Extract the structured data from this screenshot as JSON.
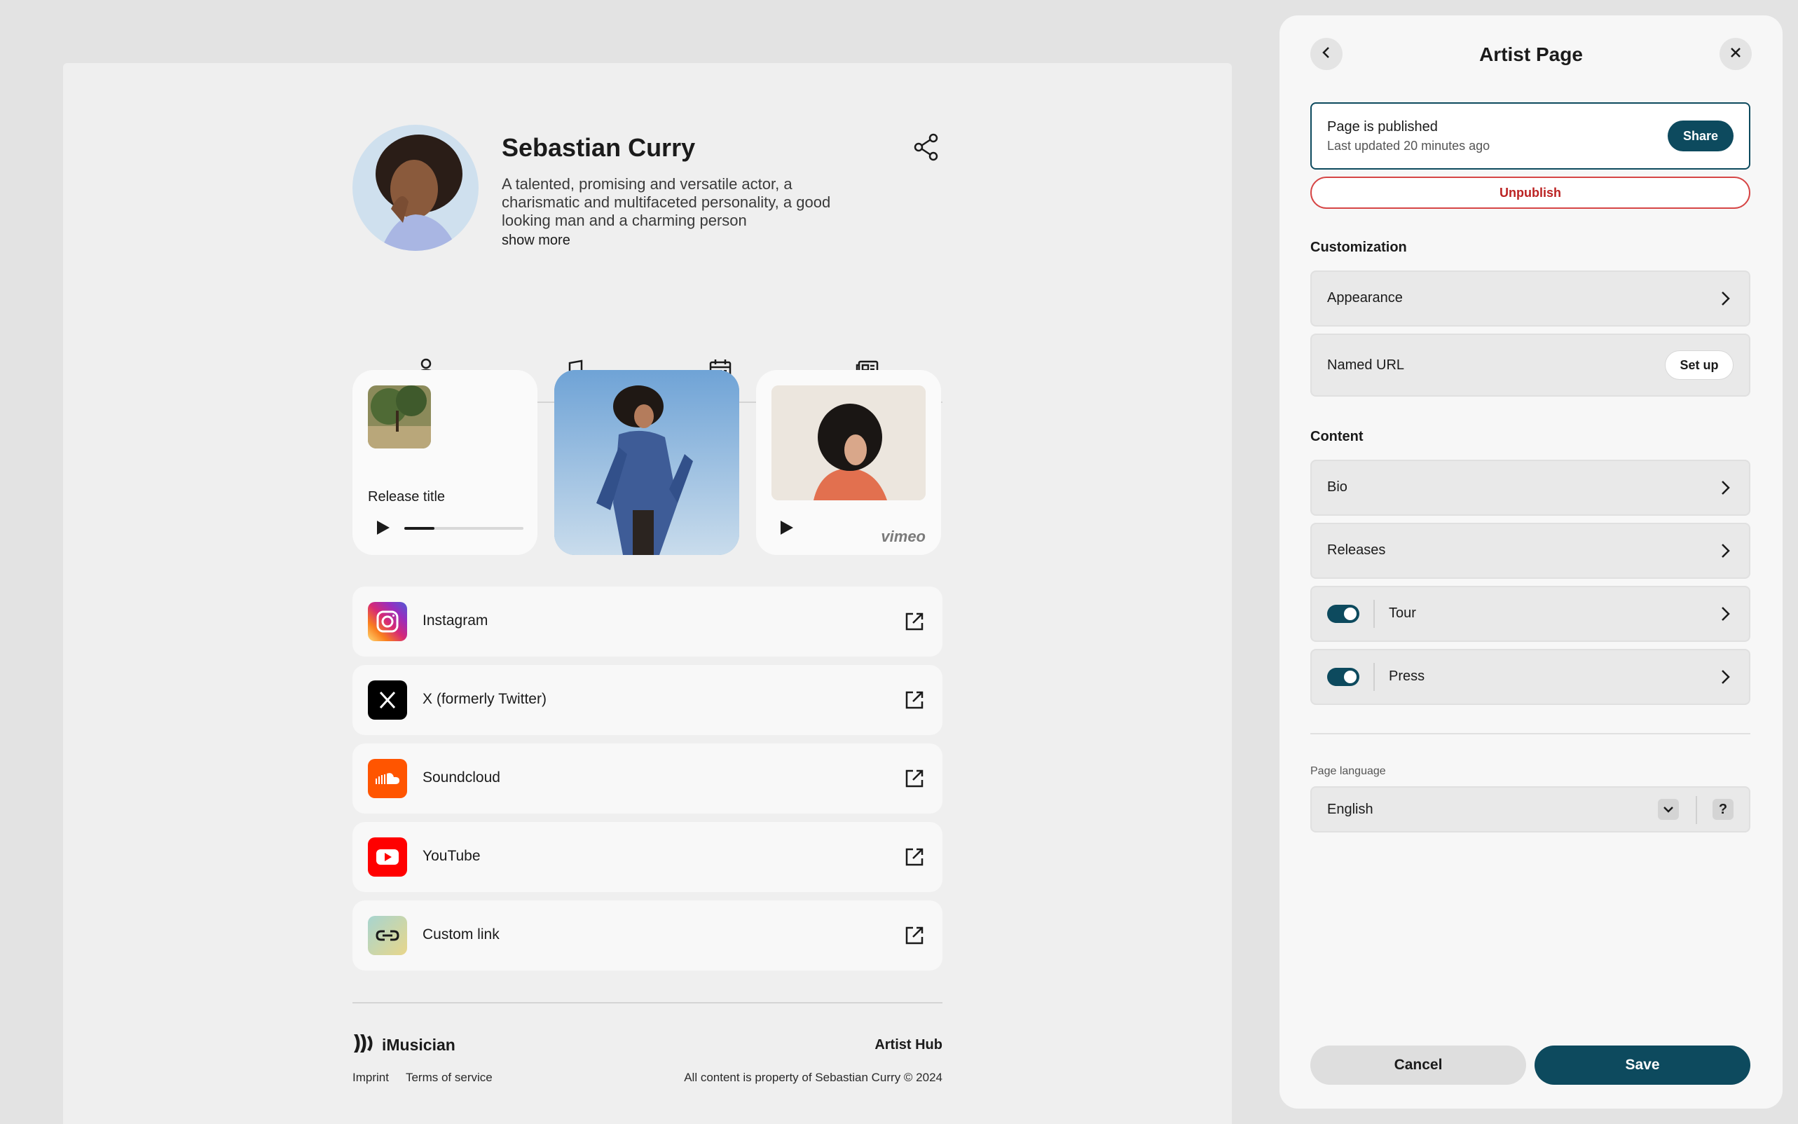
{
  "profile": {
    "name": "Sebastian Curry",
    "bio": "A talented, promising and versatile actor, a charismatic and multifaceted personality, a good looking man and a charming person",
    "show_more": "show more"
  },
  "tabs": [
    {
      "icon": "person-icon"
    },
    {
      "icon": "music-note-icon"
    },
    {
      "icon": "calendar-icon"
    },
    {
      "icon": "newspaper-icon"
    }
  ],
  "release": {
    "title": "Release title",
    "progress": 0.25
  },
  "video": {
    "provider": "vimeo"
  },
  "links": [
    {
      "label": "Instagram",
      "icon": "instagram-icon"
    },
    {
      "label": "X (formerly Twitter)",
      "icon": "x-icon"
    },
    {
      "label": "Soundcloud",
      "icon": "soundcloud-icon"
    },
    {
      "label": "YouTube",
      "icon": "youtube-icon"
    },
    {
      "label": "Custom link",
      "icon": "link-icon"
    }
  ],
  "footer": {
    "brand": "iMusician",
    "hub": "Artist Hub",
    "imprint": "Imprint",
    "terms": "Terms of service",
    "copyright": "All content is property of Sebastian Curry  ©  2024"
  },
  "panel": {
    "title": "Artist Page",
    "status_title": "Page is published",
    "status_sub": "Last updated 20 minutes ago",
    "share": "Share",
    "unpublish": "Unpublish",
    "customization": "Customization",
    "appearance": "Appearance",
    "named_url": "Named URL",
    "set_up": "Set up",
    "content": "Content",
    "bio": "Bio",
    "releases": "Releases",
    "tour": "Tour",
    "press": "Press",
    "tour_enabled": true,
    "press_enabled": true,
    "language_label": "Page language",
    "language": "English",
    "help": "?",
    "cancel": "Cancel",
    "save": "Save"
  },
  "colors": {
    "accent": "#0d4a5e",
    "danger": "#d64545",
    "instagram": "#e1306c",
    "soundcloud": "#ff5500",
    "youtube": "#ff0000"
  }
}
